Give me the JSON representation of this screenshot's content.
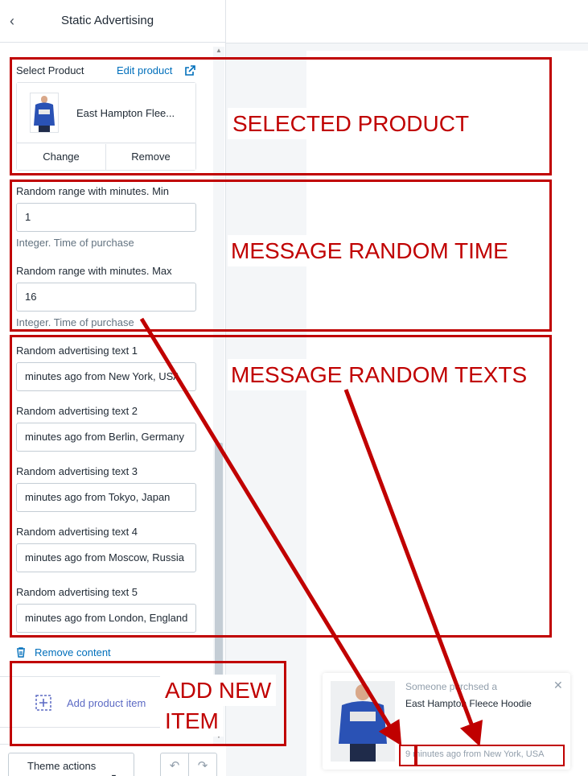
{
  "sidebar": {
    "header": {
      "back_icon": "chevron-left-icon",
      "title": "Static Advertising"
    },
    "product": {
      "label": "Select Product",
      "edit_link": "Edit product",
      "name": "East Hampton Flee...",
      "change_label": "Change",
      "remove_label": "Remove"
    },
    "random_time": {
      "min_label": "Random range with minutes. Min",
      "min_value": "1",
      "min_help": "Integer. Time of purchase",
      "max_label": "Random range with minutes. Max",
      "max_value": "16",
      "max_help": "Integer. Time of purchase"
    },
    "texts": [
      {
        "label": "Random advertising text 1",
        "value": "minutes ago from New York, USA"
      },
      {
        "label": "Random advertising text 2",
        "value": "minutes ago from Berlin, Germany"
      },
      {
        "label": "Random advertising text 3",
        "value": "minutes ago from Tokyo, Japan"
      },
      {
        "label": "Random advertising text 4",
        "value": "minutes ago from Moscow, Russia"
      },
      {
        "label": "Random advertising text 5",
        "value": "minutes ago from London, England"
      }
    ],
    "remove_content": "Remove content",
    "add_item": "Add product item",
    "footer": {
      "theme_actions": "Theme actions",
      "undo_icon": "undo-icon",
      "redo_icon": "redo-icon"
    }
  },
  "preview": {
    "popup": {
      "line1": "Someone purchsed a",
      "line2": "East Hampton Fleece Hoodie",
      "time": "9 minutes ago from New York, USA",
      "close_icon": "close-icon"
    }
  },
  "annotations": {
    "selected_product": "SELECTED PRODUCT",
    "random_time": "MESSAGE RANDOM TIME",
    "random_texts": "MESSAGE RANDOM TEXTS",
    "add_new_line1": "ADD NEW",
    "add_new_line2": "ITEM"
  },
  "colors": {
    "annotation": "#c00000",
    "link": "#006fbb",
    "add": "#5c6ac4"
  }
}
